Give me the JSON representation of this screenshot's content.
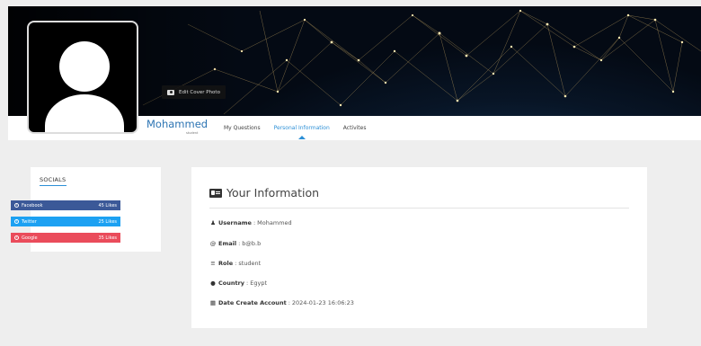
{
  "cover": {
    "edit_label": "Edit Cover Photo"
  },
  "profile": {
    "name": "Mohammed",
    "role_sub": "student"
  },
  "tabs": [
    {
      "label": "My Questions",
      "active": false
    },
    {
      "label": "Personal Information",
      "active": true
    },
    {
      "label": "Activites",
      "active": false
    }
  ],
  "socials": {
    "title": "SOCIALS",
    "items": [
      {
        "name": "Facebook",
        "count": "45 Likes",
        "color": "#3b5998"
      },
      {
        "name": "Twitter",
        "count": "25 Likes",
        "color": "#1da1f2"
      },
      {
        "name": "Google",
        "count": "35 Likes",
        "color": "#ea4c5b"
      }
    ]
  },
  "info": {
    "title": "Your Information",
    "username": {
      "label": "Username",
      "value": "Mohammed",
      "icon": "user-icon"
    },
    "email": {
      "label": "Email",
      "value": "b@b.b",
      "icon": "at-icon"
    },
    "role": {
      "label": "Role",
      "value": "student",
      "icon": "list-icon"
    },
    "country": {
      "label": "Country",
      "value": "Egypt",
      "icon": "globe-icon"
    },
    "created": {
      "label": "Date Create Account",
      "value": "2024-01-23 16:06:23",
      "icon": "calendar-icon"
    }
  },
  "colors": {
    "accent": "#2c8fd6",
    "name": "#2c74b3"
  }
}
